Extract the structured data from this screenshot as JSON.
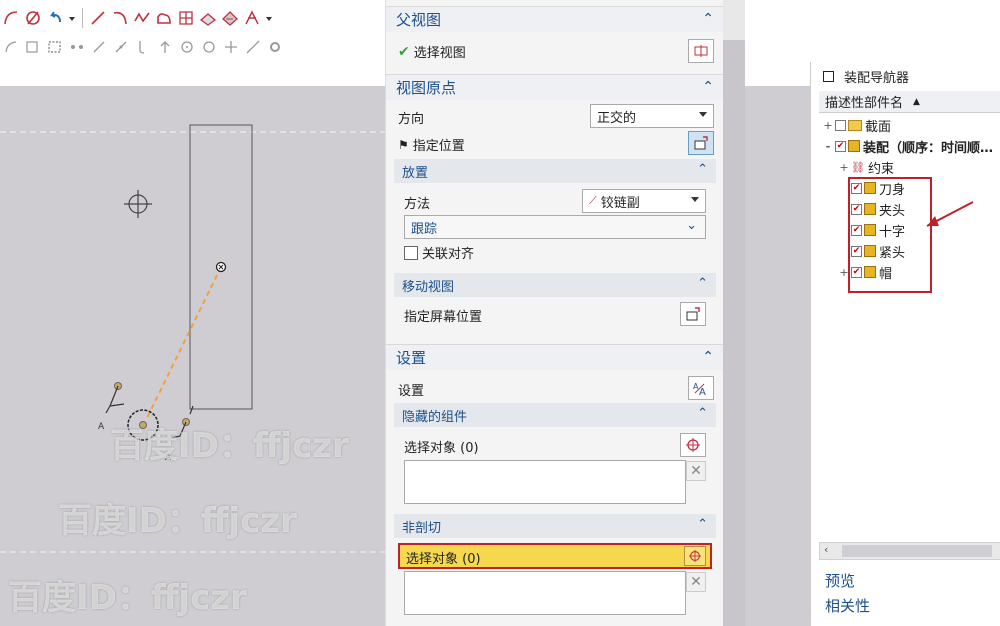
{
  "toolbar": {
    "row1_icons": [
      "arc-icon",
      "no-symbol-icon",
      "undo-arrow-icon",
      "dropdown-icon",
      "line-icon",
      "curve-icon",
      "spline-icon",
      "shape-icon",
      "grid-shape-icon",
      "plane-icon",
      "surface-icon",
      "trim-icon",
      "more-icon"
    ],
    "row2_icons": [
      "curve-small-icon",
      "select-icon",
      "box-select-icon",
      "points-icon",
      "slash-icon",
      "slash2-icon",
      "hook-icon",
      "up-icon",
      "circle-icon",
      "circle2-icon",
      "plus-icon",
      "line-small-icon",
      "gear-small-icon"
    ]
  },
  "dialog": {
    "parent_view": {
      "title": "父视图",
      "select_view_label": "选择视图"
    },
    "view_origin": {
      "title": "视图原点",
      "direction_label": "方向",
      "direction_value": "正交的",
      "specify_location_label": "指定位置",
      "placement": {
        "title": "放置",
        "method_label": "方法",
        "method_value": "铰链副",
        "track_label": "跟踪",
        "assoc_align_label": "关联对齐"
      },
      "move_view": {
        "title": "移动视图",
        "specify_screen_label": "指定屏幕位置"
      }
    },
    "settings": {
      "title": "设置",
      "settings_label": "设置",
      "hidden_components": {
        "title": "隐藏的组件",
        "select_label": "选择对象 (0)"
      },
      "non_section": {
        "title": "非剖切",
        "select_label": "选择对象 (0)"
      }
    }
  },
  "navigator": {
    "title": "装配导航器",
    "column_header": "描述性部件名",
    "tree": [
      {
        "label": "截面",
        "level": 0,
        "expander": "+"
      },
      {
        "label": "装配（顺序：时间顺…",
        "level": 0,
        "expander": "-"
      },
      {
        "label": "约束",
        "level": 1,
        "expander": "+"
      },
      {
        "label": "刀身",
        "level": 1,
        "expander": ""
      },
      {
        "label": "夹头",
        "level": 1,
        "expander": ""
      },
      {
        "label": "十字",
        "level": 1,
        "expander": ""
      },
      {
        "label": "紧头",
        "level": 1,
        "expander": ""
      },
      {
        "label": "帽",
        "level": 1,
        "expander": "+"
      }
    ],
    "preview_label": "预览",
    "relevance_label": "相关性"
  },
  "watermark": {
    "text": "百度ID：ffjczr"
  },
  "colors": {
    "accent": "#1d4f8a",
    "highlight_fill": "#f6d84f",
    "annotation_red": "#c0202a",
    "canvas_bg": "#cfcdd2"
  }
}
